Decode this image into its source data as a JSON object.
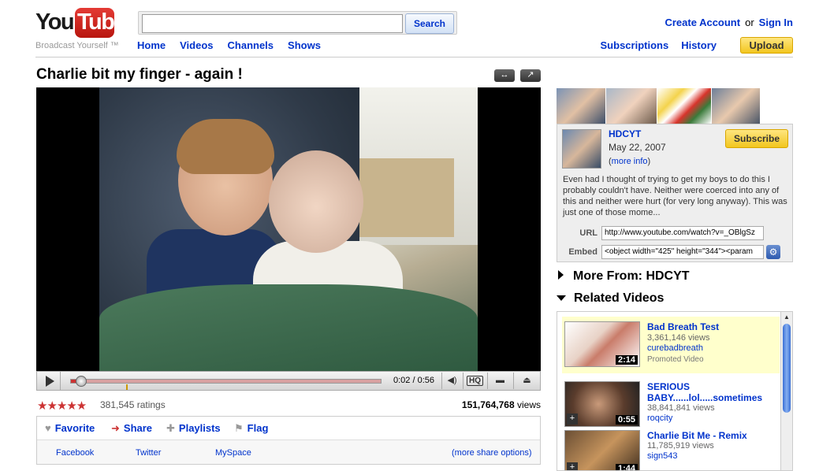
{
  "header": {
    "logo_you": "You",
    "logo_tube": "Tube",
    "tagline": "Broadcast Yourself ™",
    "search_placeholder": "",
    "search_button": "Search",
    "nav": [
      "Home",
      "Videos",
      "Channels",
      "Shows"
    ],
    "create_account": "Create Account",
    "or": "or",
    "sign_in": "Sign In",
    "subscriptions": "Subscriptions",
    "history": "History",
    "upload": "Upload"
  },
  "video": {
    "title": "Charlie bit my finger - again !",
    "time": "0:02 / 0:56",
    "hq": "HQ",
    "progress_fraction": 0.036,
    "rating_stars": "★★★★★",
    "ratings": "381,545 ratings",
    "views_count": "151,764,768",
    "views_label": "views",
    "actions": {
      "favorite": "Favorite",
      "share": "Share",
      "playlists": "Playlists",
      "flag": "Flag"
    },
    "share_links": [
      "Facebook",
      "Twitter",
      "MySpace"
    ],
    "more_share": "(more share options)"
  },
  "channel": {
    "name": "HDCYT",
    "date": "May 22, 2007",
    "more_info": "more info",
    "subscribe": "Subscribe",
    "description": "Even had I thought of trying to get my boys to do this I probably couldn't have. Neither were coerced into any of this and neither were hurt (for very long anyway). This was just one of those mome...",
    "url_label": "URL",
    "url_value": "http://www.youtube.com/watch?v=_OBlgSz",
    "embed_label": "Embed",
    "embed_value": "<object width=\"425\" height=\"344\"><param"
  },
  "more_from": "More From: HDCYT",
  "related_heading": "Related Videos",
  "related": [
    {
      "title": "Bad Breath Test",
      "views": "3,361,146 views",
      "user": "curebadbreath",
      "promo": "Promoted Video",
      "duration": "2:14"
    },
    {
      "title": "SERIOUS BABY......lol.....sometimes",
      "views": "38,841,841 views",
      "user": "roqcity",
      "duration": "0:55"
    },
    {
      "title": "Charlie Bit Me - Remix",
      "views": "11,785,919 views",
      "user": "sign543",
      "duration": "1:44"
    }
  ],
  "colors": {
    "link": "#0033cc",
    "logo_red": "#cc181e",
    "promo_bg": "#ffffcc",
    "upload_yellow": "#f2c61f"
  }
}
